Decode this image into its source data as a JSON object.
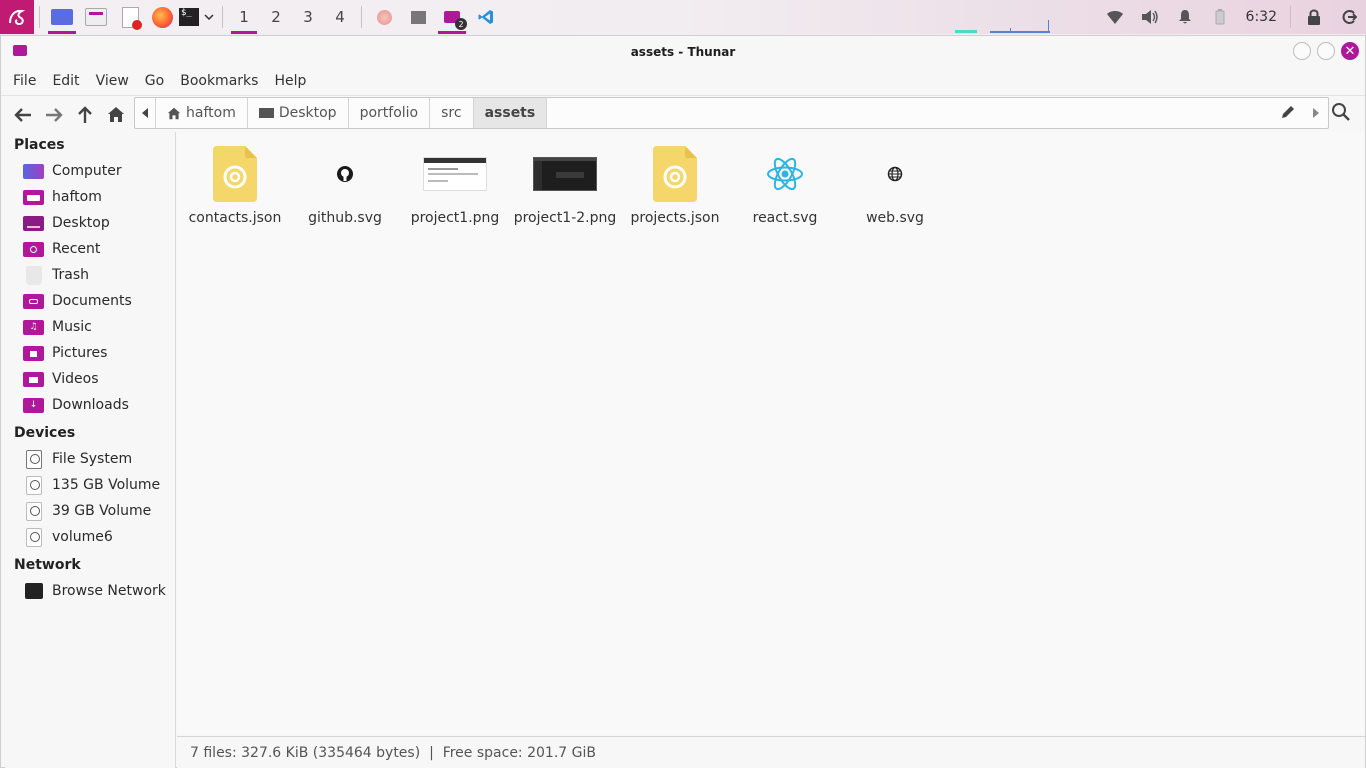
{
  "panel": {
    "workspaces": [
      "1",
      "2",
      "3",
      "4"
    ],
    "thunar_badge": "2",
    "clock": "6:32",
    "accent": "#b0189a"
  },
  "window": {
    "title": "assets - Thunar"
  },
  "menu": [
    "File",
    "Edit",
    "View",
    "Go",
    "Bookmarks",
    "Help"
  ],
  "path": {
    "crumbs": [
      "haftom",
      "Desktop",
      "portfolio",
      "src",
      "assets"
    ]
  },
  "sidebar": {
    "places_title": "Places",
    "places": [
      "Computer",
      "haftom",
      "Desktop",
      "Recent",
      "Trash",
      "Documents",
      "Music",
      "Pictures",
      "Videos",
      "Downloads"
    ],
    "devices_title": "Devices",
    "devices": [
      "File System",
      "135 GB Volume",
      "39 GB Volume",
      "volume6"
    ],
    "network_title": "Network",
    "network": [
      "Browse Network"
    ]
  },
  "files": [
    {
      "name": "contacts.json",
      "icon": "json-file-icon"
    },
    {
      "name": "github.svg",
      "icon": "github-icon"
    },
    {
      "name": "project1.png",
      "icon": "image-thumbnail"
    },
    {
      "name": "project1-2.png",
      "icon": "image-thumbnail-dark"
    },
    {
      "name": "projects.json",
      "icon": "json-file-icon"
    },
    {
      "name": "react.svg",
      "icon": "react-icon"
    },
    {
      "name": "web.svg",
      "icon": "globe-icon"
    }
  ],
  "status": "7 files: 327.6 KiB (335464 bytes)  |  Free space: 201.7 GiB"
}
